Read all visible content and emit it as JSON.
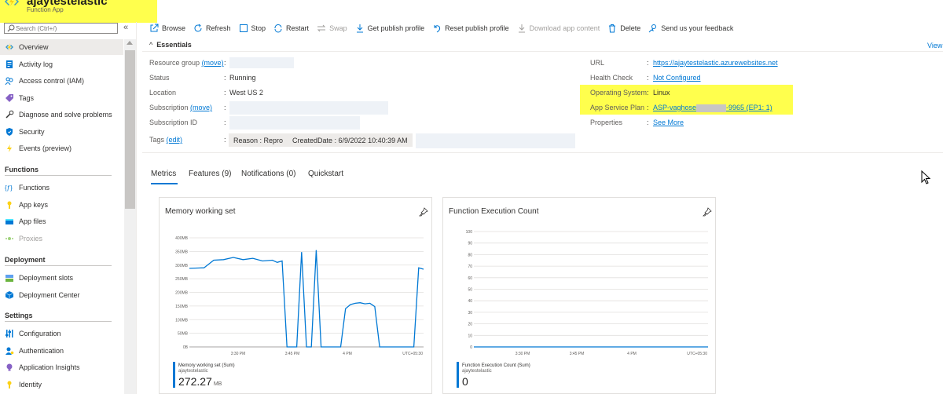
{
  "app": {
    "title": "ajaytestelastic",
    "subtitle": "Function App"
  },
  "sidebar": {
    "search_placeholder": "Search (Ctrl+/)",
    "collapse": "«",
    "items": [
      {
        "label": "Overview",
        "icon": "lightning-icon"
      },
      {
        "label": "Activity log",
        "icon": "log-icon"
      },
      {
        "label": "Access control (IAM)",
        "icon": "people-icon"
      },
      {
        "label": "Tags",
        "icon": "tag-icon"
      },
      {
        "label": "Diagnose and solve problems",
        "icon": "wrench-icon"
      },
      {
        "label": "Security",
        "icon": "shield-icon"
      },
      {
        "label": "Events (preview)",
        "icon": "lightning-icon"
      }
    ],
    "sections": [
      {
        "title": "Functions",
        "items": [
          {
            "label": "Functions",
            "icon": "function-icon"
          },
          {
            "label": "App keys",
            "icon": "key-icon"
          },
          {
            "label": "App files",
            "icon": "files-icon"
          },
          {
            "label": "Proxies",
            "icon": "proxy-icon"
          }
        ]
      },
      {
        "title": "Deployment",
        "items": [
          {
            "label": "Deployment slots",
            "icon": "slots-icon"
          },
          {
            "label": "Deployment Center",
            "icon": "cube-icon"
          }
        ]
      },
      {
        "title": "Settings",
        "items": [
          {
            "label": "Configuration",
            "icon": "sliders-icon"
          },
          {
            "label": "Authentication",
            "icon": "person-icon"
          },
          {
            "label": "Application Insights",
            "icon": "bulb-icon"
          },
          {
            "label": "Identity",
            "icon": "key-icon"
          }
        ]
      }
    ]
  },
  "toolbar": [
    {
      "label": "Browse",
      "icon": "external-link-icon"
    },
    {
      "label": "Refresh",
      "icon": "refresh-icon"
    },
    {
      "label": "Stop",
      "icon": "stop-icon"
    },
    {
      "label": "Restart",
      "icon": "restart-icon"
    },
    {
      "label": "Swap",
      "icon": "swap-icon",
      "disabled": true
    },
    {
      "label": "Get publish profile",
      "icon": "download-icon"
    },
    {
      "label": "Reset publish profile",
      "icon": "undo-icon"
    },
    {
      "label": "Download app content",
      "icon": "download-icon",
      "disabled": true
    },
    {
      "label": "Delete",
      "icon": "trash-icon"
    },
    {
      "label": "Send us your feedback",
      "icon": "feedback-icon"
    }
  ],
  "essentials": {
    "title": "Essentials",
    "view": "View",
    "resource_group_label": "Resource group",
    "move": "(move)",
    "colon": ":",
    "status_label": "Status",
    "status_value": "Running",
    "location_label": "Location",
    "location_value": "West US 2",
    "subscription_label": "Subscription",
    "subscription_id_label": "Subscription ID",
    "tags_label": "Tags",
    "edit": "(edit)",
    "tags": [
      "Reason : Repro",
      "CreatedDate : 6/9/2022 10:40:39 AM"
    ],
    "url_label": "URL",
    "url_value": "https://ajaytestelastic.azurewebsites.net",
    "health_label": "Health Check",
    "health_value": "Not Configured",
    "os_label": "Operating System",
    "os_value": "Linux",
    "plan_label": "App Service Plan",
    "plan_value_start": "ASP-vaghose",
    "plan_value_end": "-9965 (EP1: 1)",
    "props_label": "Properties",
    "props_value": "See More"
  },
  "tabs": [
    "Metrics",
    "Features (9)",
    "Notifications (0)",
    "Quickstart"
  ],
  "charts": {
    "memory": {
      "title": "Memory working set",
      "legend_name": "Memory working set (Sum)",
      "legend_resource": "ajaytestelastic",
      "legend_value": "272.27",
      "legend_unit": "MB"
    },
    "exec": {
      "title": "Function Execution Count",
      "legend_name": "Function Execution Count (Sum)",
      "legend_resource": "ajaytestelastic",
      "legend_value": "0"
    }
  },
  "chart_data": [
    {
      "type": "line",
      "title": "Memory working set",
      "y_ticks": [
        "400MB",
        "350MB",
        "300MB",
        "250MB",
        "200MB",
        "150MB",
        "100MB",
        "50MB",
        "0B"
      ],
      "x_ticks": [
        "3:30 PM",
        "3:45 PM",
        "4 PM",
        "UTC+05:30"
      ],
      "ylim": [
        0,
        400
      ],
      "series": [
        {
          "name": "Memory working set (Sum)",
          "x": [
            0,
            3,
            5,
            7,
            9,
            11,
            13,
            15,
            17,
            18,
            19,
            20,
            21,
            22,
            23,
            24,
            25,
            26,
            27,
            28,
            29,
            30,
            31,
            32,
            33,
            34,
            35,
            36,
            37,
            38,
            39,
            40,
            41,
            42,
            43,
            44,
            45,
            46,
            47,
            48
          ],
          "values": [
            288,
            290,
            318,
            320,
            328,
            320,
            325,
            315,
            318,
            310,
            315,
            0,
            0,
            0,
            348,
            0,
            0,
            355,
            0,
            0,
            0,
            0,
            0,
            140,
            155,
            160,
            162,
            158,
            160,
            148,
            0,
            0,
            0,
            0,
            0,
            0,
            0,
            0,
            290,
            285
          ]
        }
      ]
    },
    {
      "type": "line",
      "title": "Function Execution Count",
      "y_ticks": [
        "100",
        "90",
        "80",
        "70",
        "60",
        "50",
        "40",
        "30",
        "20",
        "10",
        "0"
      ],
      "x_ticks": [
        "3:30 PM",
        "3:45 PM",
        "4 PM",
        "UTC+05:30"
      ],
      "ylim": [
        0,
        100
      ],
      "series": [
        {
          "name": "Function Execution Count (Sum)",
          "x": [
            0,
            48
          ],
          "values": [
            0,
            0
          ]
        }
      ]
    }
  ],
  "colors": {
    "accent": "#0078d4",
    "highlight": "#ffff4d"
  }
}
